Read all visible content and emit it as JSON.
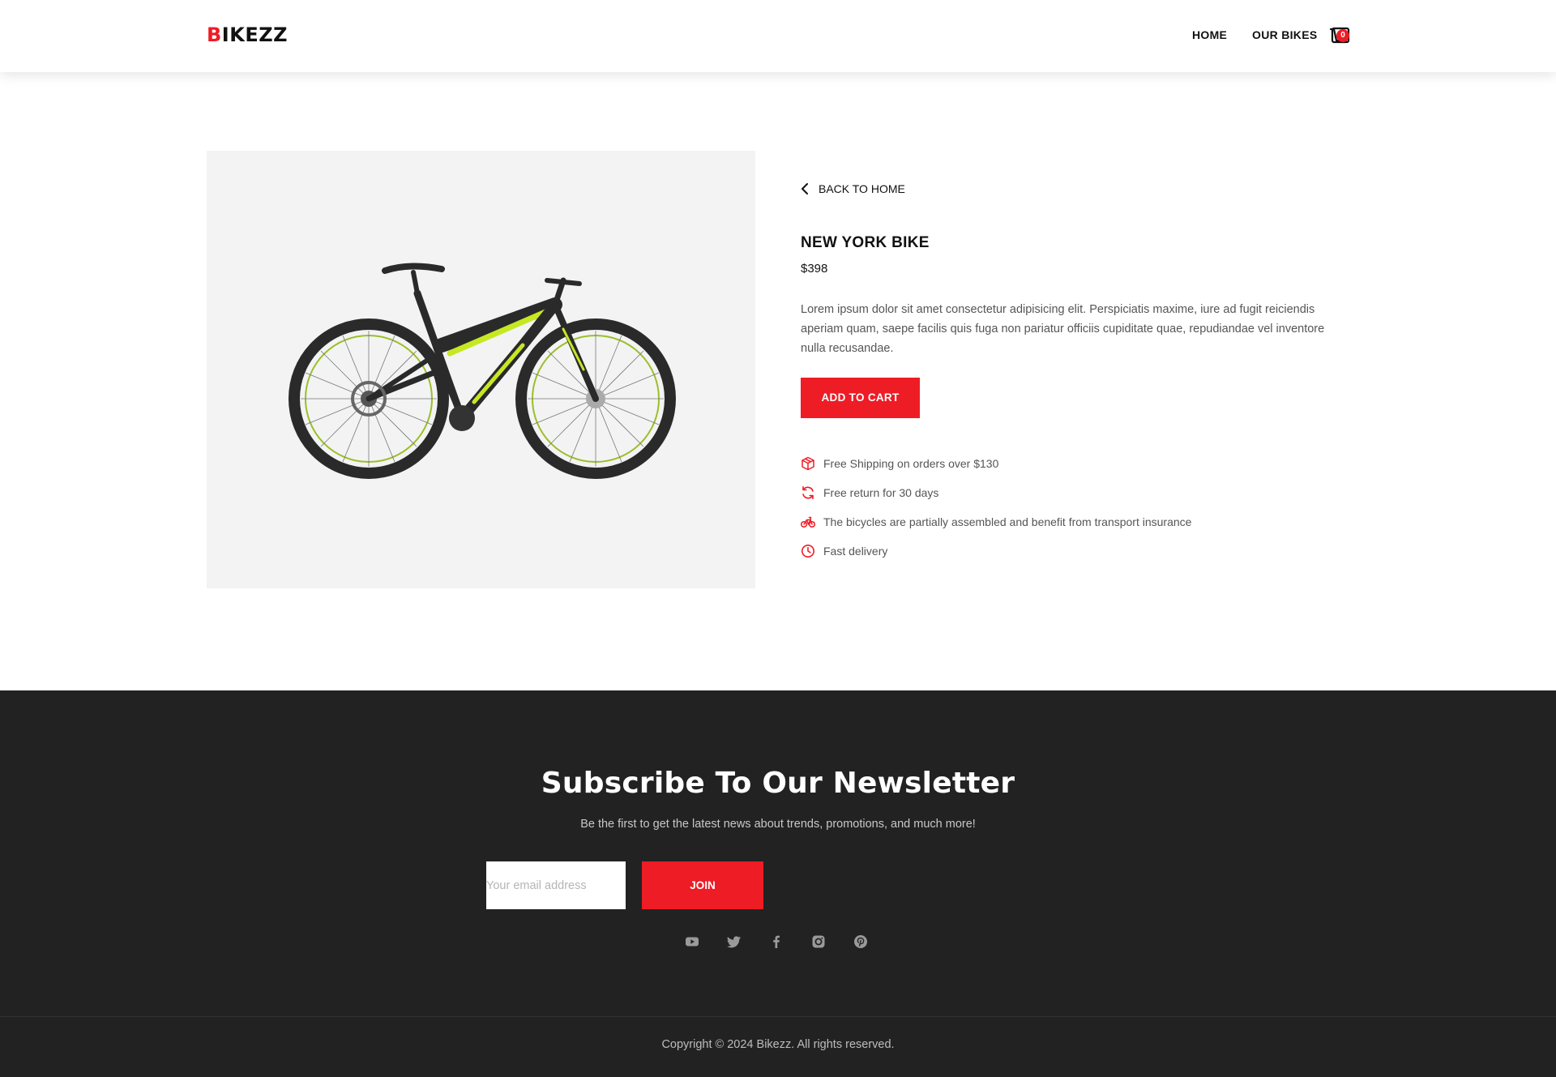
{
  "header": {
    "logo_first": "B",
    "logo_rest": "IKEZZ",
    "nav": {
      "home": "HOME",
      "our_bikes": "OUR BIKES"
    },
    "cart": {
      "icon": "cart-icon",
      "count": "0"
    }
  },
  "product": {
    "back_label": "BACK TO HOME",
    "name": "NEW YORK BIKE",
    "price": "$398",
    "description": "Lorem ipsum dolor sit amet consectetur adipisicing elit. Perspiciatis maxime, iure ad fugit reiciendis aperiam quam, saepe facilis quis fuga non pariatur officiis cupiditate quae, repudiandae vel inventore nulla recusandae.",
    "add_to_cart": "ADD TO CART",
    "features": [
      {
        "icon": "box-icon",
        "text": "Free Shipping on orders over $130"
      },
      {
        "icon": "refresh-icon",
        "text": "Free return for 30 days"
      },
      {
        "icon": "bicycle-icon",
        "text": "The bicycles are partially assembled and benefit from transport insurance"
      },
      {
        "icon": "clock-icon",
        "text": "Fast delivery"
      }
    ]
  },
  "newsletter": {
    "title": "Subscribe To Our Newsletter",
    "subtitle": "Be the first to get the latest news about trends, promotions, and much more!",
    "email_placeholder": "Your email address",
    "join_label": "JOIN",
    "socials": [
      "youtube-icon",
      "twitter-icon",
      "facebook-icon",
      "instagram-icon",
      "pinterest-icon"
    ]
  },
  "footer": {
    "copyright": "Copyright © 2024 Bikezz. All rights reserved."
  },
  "colors": {
    "accent": "#ee1c25",
    "dark": "#222222",
    "image_bg": "#f3f3f3"
  }
}
